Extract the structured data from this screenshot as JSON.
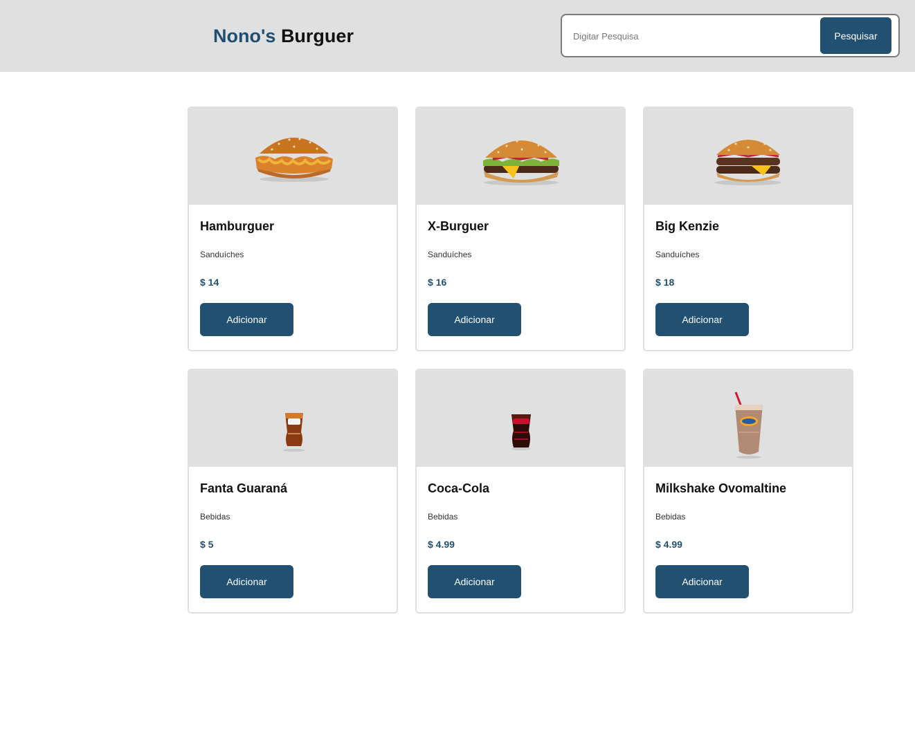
{
  "header": {
    "brand_first": "Nono's",
    "brand_second": "Burguer",
    "brand_color": "#1f4e70",
    "background": "#e0e0e0"
  },
  "search": {
    "placeholder": "Digitar Pesquisa",
    "value": "",
    "button_label": "Pesquisar"
  },
  "accent_color": "#215070",
  "products": [
    {
      "name": "Hamburguer",
      "category": "Sanduíches",
      "price": "$ 14",
      "button_label": "Adicionar",
      "image": "hamburger-image"
    },
    {
      "name": "X-Burguer",
      "category": "Sanduíches",
      "price": "$ 16",
      "button_label": "Adicionar",
      "image": "cheeseburger-image"
    },
    {
      "name": "Big Kenzie",
      "category": "Sanduíches",
      "price": "$ 18",
      "button_label": "Adicionar",
      "image": "double-burger-image"
    },
    {
      "name": "Fanta Guaraná",
      "category": "Bebidas",
      "price": "$ 5",
      "button_label": "Adicionar",
      "image": "soda-glass-image"
    },
    {
      "name": "Coca-Cola",
      "category": "Bebidas",
      "price": "$ 4.99",
      "button_label": "Adicionar",
      "image": "cola-glass-image"
    },
    {
      "name": "Milkshake Ovomaltine",
      "category": "Bebidas",
      "price": "$ 4.99",
      "button_label": "Adicionar",
      "image": "milkshake-image"
    }
  ]
}
